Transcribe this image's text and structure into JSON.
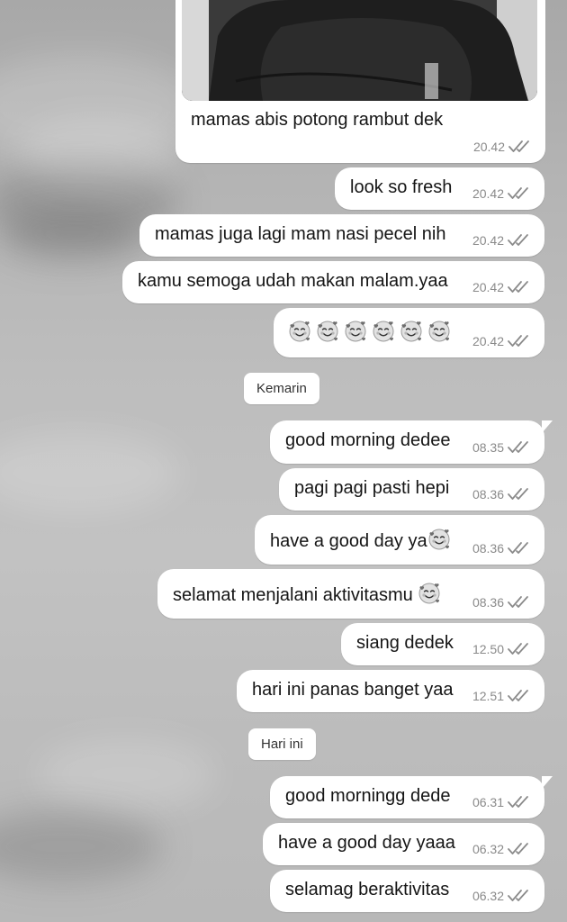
{
  "chat": {
    "day_labels": {
      "yesterday": "Kemarin",
      "today": "Hari ini"
    },
    "messages": [
      {
        "text": "mamas abis potong rambut dek",
        "time": "20.42",
        "status": "read",
        "has_photo": true
      },
      {
        "text": "look so fresh",
        "time": "20.42",
        "status": "read"
      },
      {
        "text": "mamas juga lagi mam nasi pecel nih",
        "time": "20.42",
        "status": "read"
      },
      {
        "text": "kamu semoga udah makan malam.yaa",
        "time": "20.42",
        "status": "read"
      },
      {
        "text": "",
        "emoji": "smiling-face-with-hearts",
        "emoji_count": 6,
        "time": "20.42",
        "status": "read"
      },
      {
        "text": "good morning dedee",
        "time": "08.35",
        "status": "read"
      },
      {
        "text": "pagi pagi pasti hepi",
        "time": "08.36",
        "status": "read"
      },
      {
        "text": "have a good day ya",
        "emoji": "smiling-face-with-hearts",
        "time": "08.36",
        "status": "read"
      },
      {
        "text": "selamat menjalani aktivitasmu ",
        "emoji": "smiling-face-with-hearts",
        "time": "08.36",
        "status": "read"
      },
      {
        "text": "siang dedek",
        "time": "12.50",
        "status": "read"
      },
      {
        "text": "hari ini panas banget yaa",
        "time": "12.51",
        "status": "read"
      },
      {
        "text": "good morningg dede",
        "time": "06.31",
        "status": "read"
      },
      {
        "text": "have a good day yaaa",
        "time": "06.32",
        "status": "read"
      },
      {
        "text": "selamag beraktivitas",
        "time": "06.32",
        "status": "read"
      }
    ]
  },
  "colors": {
    "bubble": "#ffffff",
    "time": "#8a8a8a",
    "ticks": "#8a8a8a"
  }
}
